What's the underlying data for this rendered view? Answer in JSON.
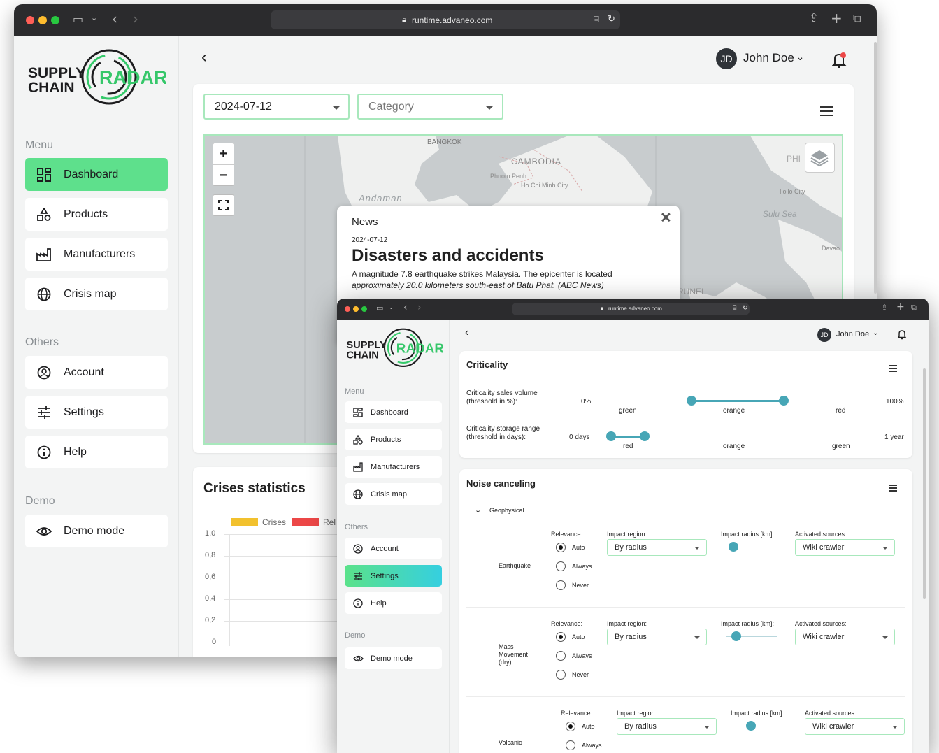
{
  "back_window": {
    "url": "runtime.advaneo.com",
    "logo": {
      "line1": "SUPPLY",
      "line2": "CHAIN",
      "word": "RADAR"
    },
    "sections": {
      "menu": "Menu",
      "others": "Others",
      "demo": "Demo"
    },
    "nav": [
      {
        "label": "Dashboard",
        "icon": "dashboard-icon",
        "active": true
      },
      {
        "label": "Products",
        "icon": "products-icon"
      },
      {
        "label": "Manufacturers",
        "icon": "factory-icon"
      },
      {
        "label": "Crisis map",
        "icon": "globe-icon"
      },
      {
        "label": "Account",
        "icon": "account-icon"
      },
      {
        "label": "Settings",
        "icon": "settings-icon"
      },
      {
        "label": "Help",
        "icon": "info-icon"
      },
      {
        "label": "Demo mode",
        "icon": "eye-icon"
      }
    ],
    "user": {
      "initials": "JD",
      "name": "John Doe"
    },
    "filters": {
      "date": "2024-07-12",
      "category_placeholder": "Category"
    },
    "map": {
      "labels": [
        "BANGKOK",
        "CAMBODIA",
        "Phnom Penh",
        "Ho Chi Minh City",
        "Andaman",
        "PHI",
        "Iloilo City",
        "Sulu Sea",
        "Davao",
        "RUNEI"
      ],
      "zoom_in": "+",
      "zoom_out": "−"
    },
    "popup": {
      "heading": "News",
      "date": "2024-07-12",
      "title": "Disasters and accidents",
      "body": "A magnitude 7.8 earthquake strikes Malaysia. The epicenter is located",
      "body2": "approximately 20.0 kilometers south-east of Batu Phat. (ABC News)"
    },
    "crises": {
      "title": "Crises statistics",
      "legend": [
        "Crises",
        "Rel"
      ],
      "legend_colors": [
        "#f2c12e",
        "#ec4747"
      ],
      "yticks": [
        "1,0",
        "0,8",
        "0,6",
        "0,4",
        "0,2",
        "0"
      ]
    }
  },
  "front_window": {
    "url": "runtime.advaneo.com",
    "logo": {
      "line1": "SUPPLY",
      "line2": "CHAIN",
      "word": "RADAR"
    },
    "sections": {
      "menu": "Menu",
      "others": "Others",
      "demo": "Demo"
    },
    "nav": [
      {
        "label": "Dashboard"
      },
      {
        "label": "Products"
      },
      {
        "label": "Manufacturers"
      },
      {
        "label": "Crisis map"
      },
      {
        "label": "Account"
      },
      {
        "label": "Settings",
        "active": true
      },
      {
        "label": "Help"
      },
      {
        "label": "Demo mode"
      }
    ],
    "user": {
      "initials": "JD",
      "name": "John Doe"
    },
    "criticality": {
      "title": "Criticality",
      "sales": {
        "label1": "Criticality sales volume",
        "label2": "(threshold in %):",
        "min": "0%",
        "max": "100%",
        "zones": [
          "green",
          "orange",
          "red"
        ],
        "low": 0.33,
        "high": 0.66
      },
      "storage": {
        "label1": "Criticality storage range",
        "label2": "(threshold in days):",
        "min": "0 days",
        "max": "1 year",
        "zones": [
          "red",
          "orange",
          "green"
        ],
        "low": 0.04,
        "high": 0.16
      }
    },
    "noise": {
      "title": "Noise canceling",
      "group": "Geophysical",
      "col_relevance": "Relevance:",
      "col_region": "Impact region:",
      "col_radius": "Impact radius [km]:",
      "col_sources": "Activated sources:",
      "options": [
        "Auto",
        "Always",
        "Never"
      ],
      "rows": [
        {
          "name": "Earthquake",
          "region": "By radius",
          "source": "Wiki crawler",
          "radius": 0.15
        },
        {
          "name": "Mass Movement (dry)",
          "name1": "Mass",
          "name2": "Movement",
          "name3": "(dry)",
          "region": "By radius",
          "source": "Wiki crawler",
          "radius": 0.2
        },
        {
          "name": "Volcanic",
          "region": "By radius",
          "source": "Wiki crawler",
          "radius": 0.3
        }
      ]
    }
  }
}
